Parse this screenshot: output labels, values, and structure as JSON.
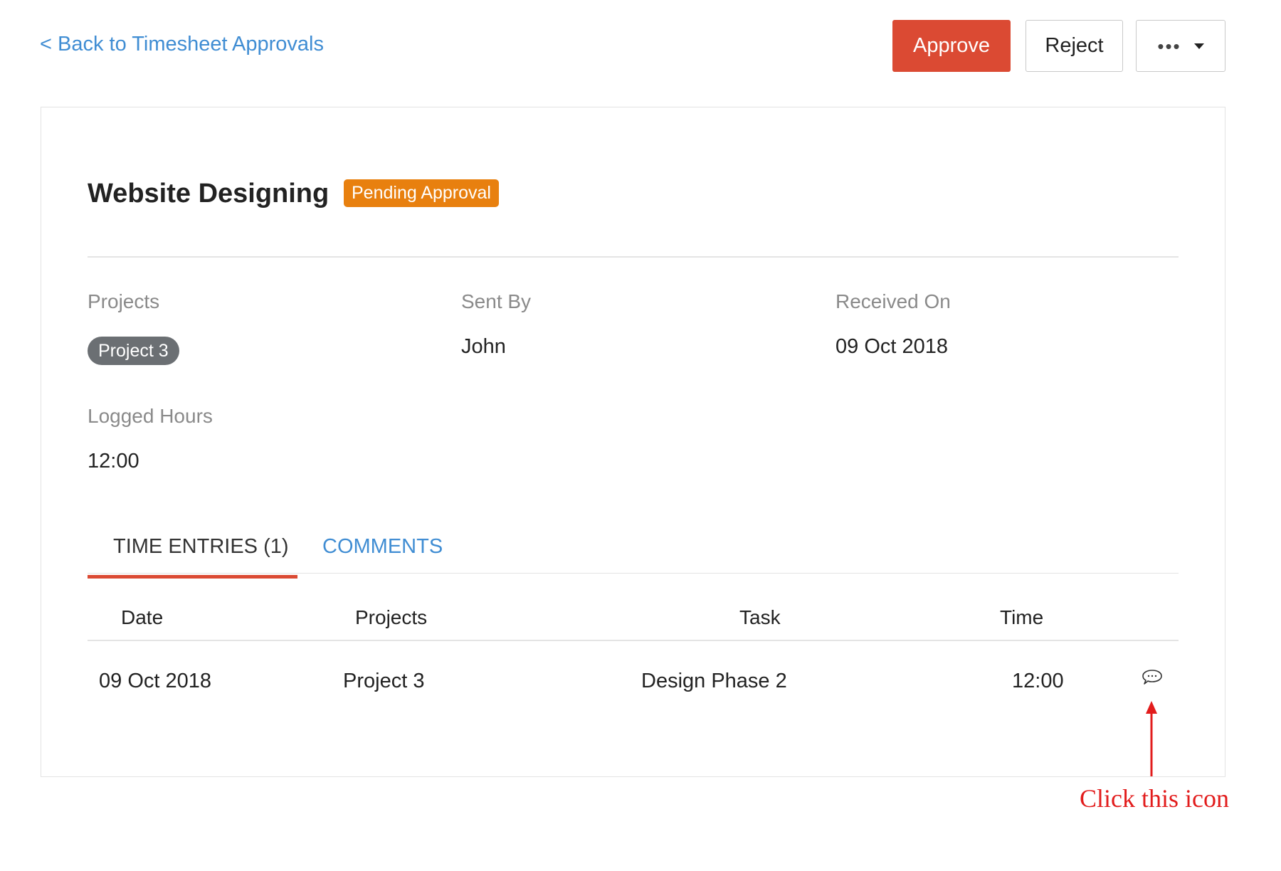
{
  "header": {
    "back_link": "< Back to Timesheet Approvals",
    "approve_label": "Approve",
    "reject_label": "Reject",
    "more_label": "•••"
  },
  "timesheet": {
    "title": "Website Designing",
    "status": "Pending Approval",
    "projects_label": "Projects",
    "project_name": "Project 3",
    "sent_by_label": "Sent By",
    "sent_by": "John",
    "received_on_label": "Received On",
    "received_on": "09 Oct 2018",
    "logged_hours_label": "Logged Hours",
    "logged_hours": "12:00"
  },
  "tabs": [
    {
      "label": "TIME ENTRIES (1)",
      "active": true
    },
    {
      "label": "COMMENTS",
      "active": false
    }
  ],
  "table": {
    "columns": [
      "Date",
      "Projects",
      "Task",
      "Time"
    ],
    "rows": [
      {
        "date": "09 Oct 2018",
        "project": "Project 3",
        "task": "Design Phase 2",
        "time": "12:00",
        "icon": "comment-icon"
      }
    ]
  },
  "annotation": {
    "text": "Click this icon"
  },
  "colors": {
    "accent_red": "#db4a33",
    "link_blue": "#408dd3",
    "badge_orange": "#e8800f",
    "pill_gray": "#6b6f73",
    "annotation_red": "#e21c1c"
  }
}
